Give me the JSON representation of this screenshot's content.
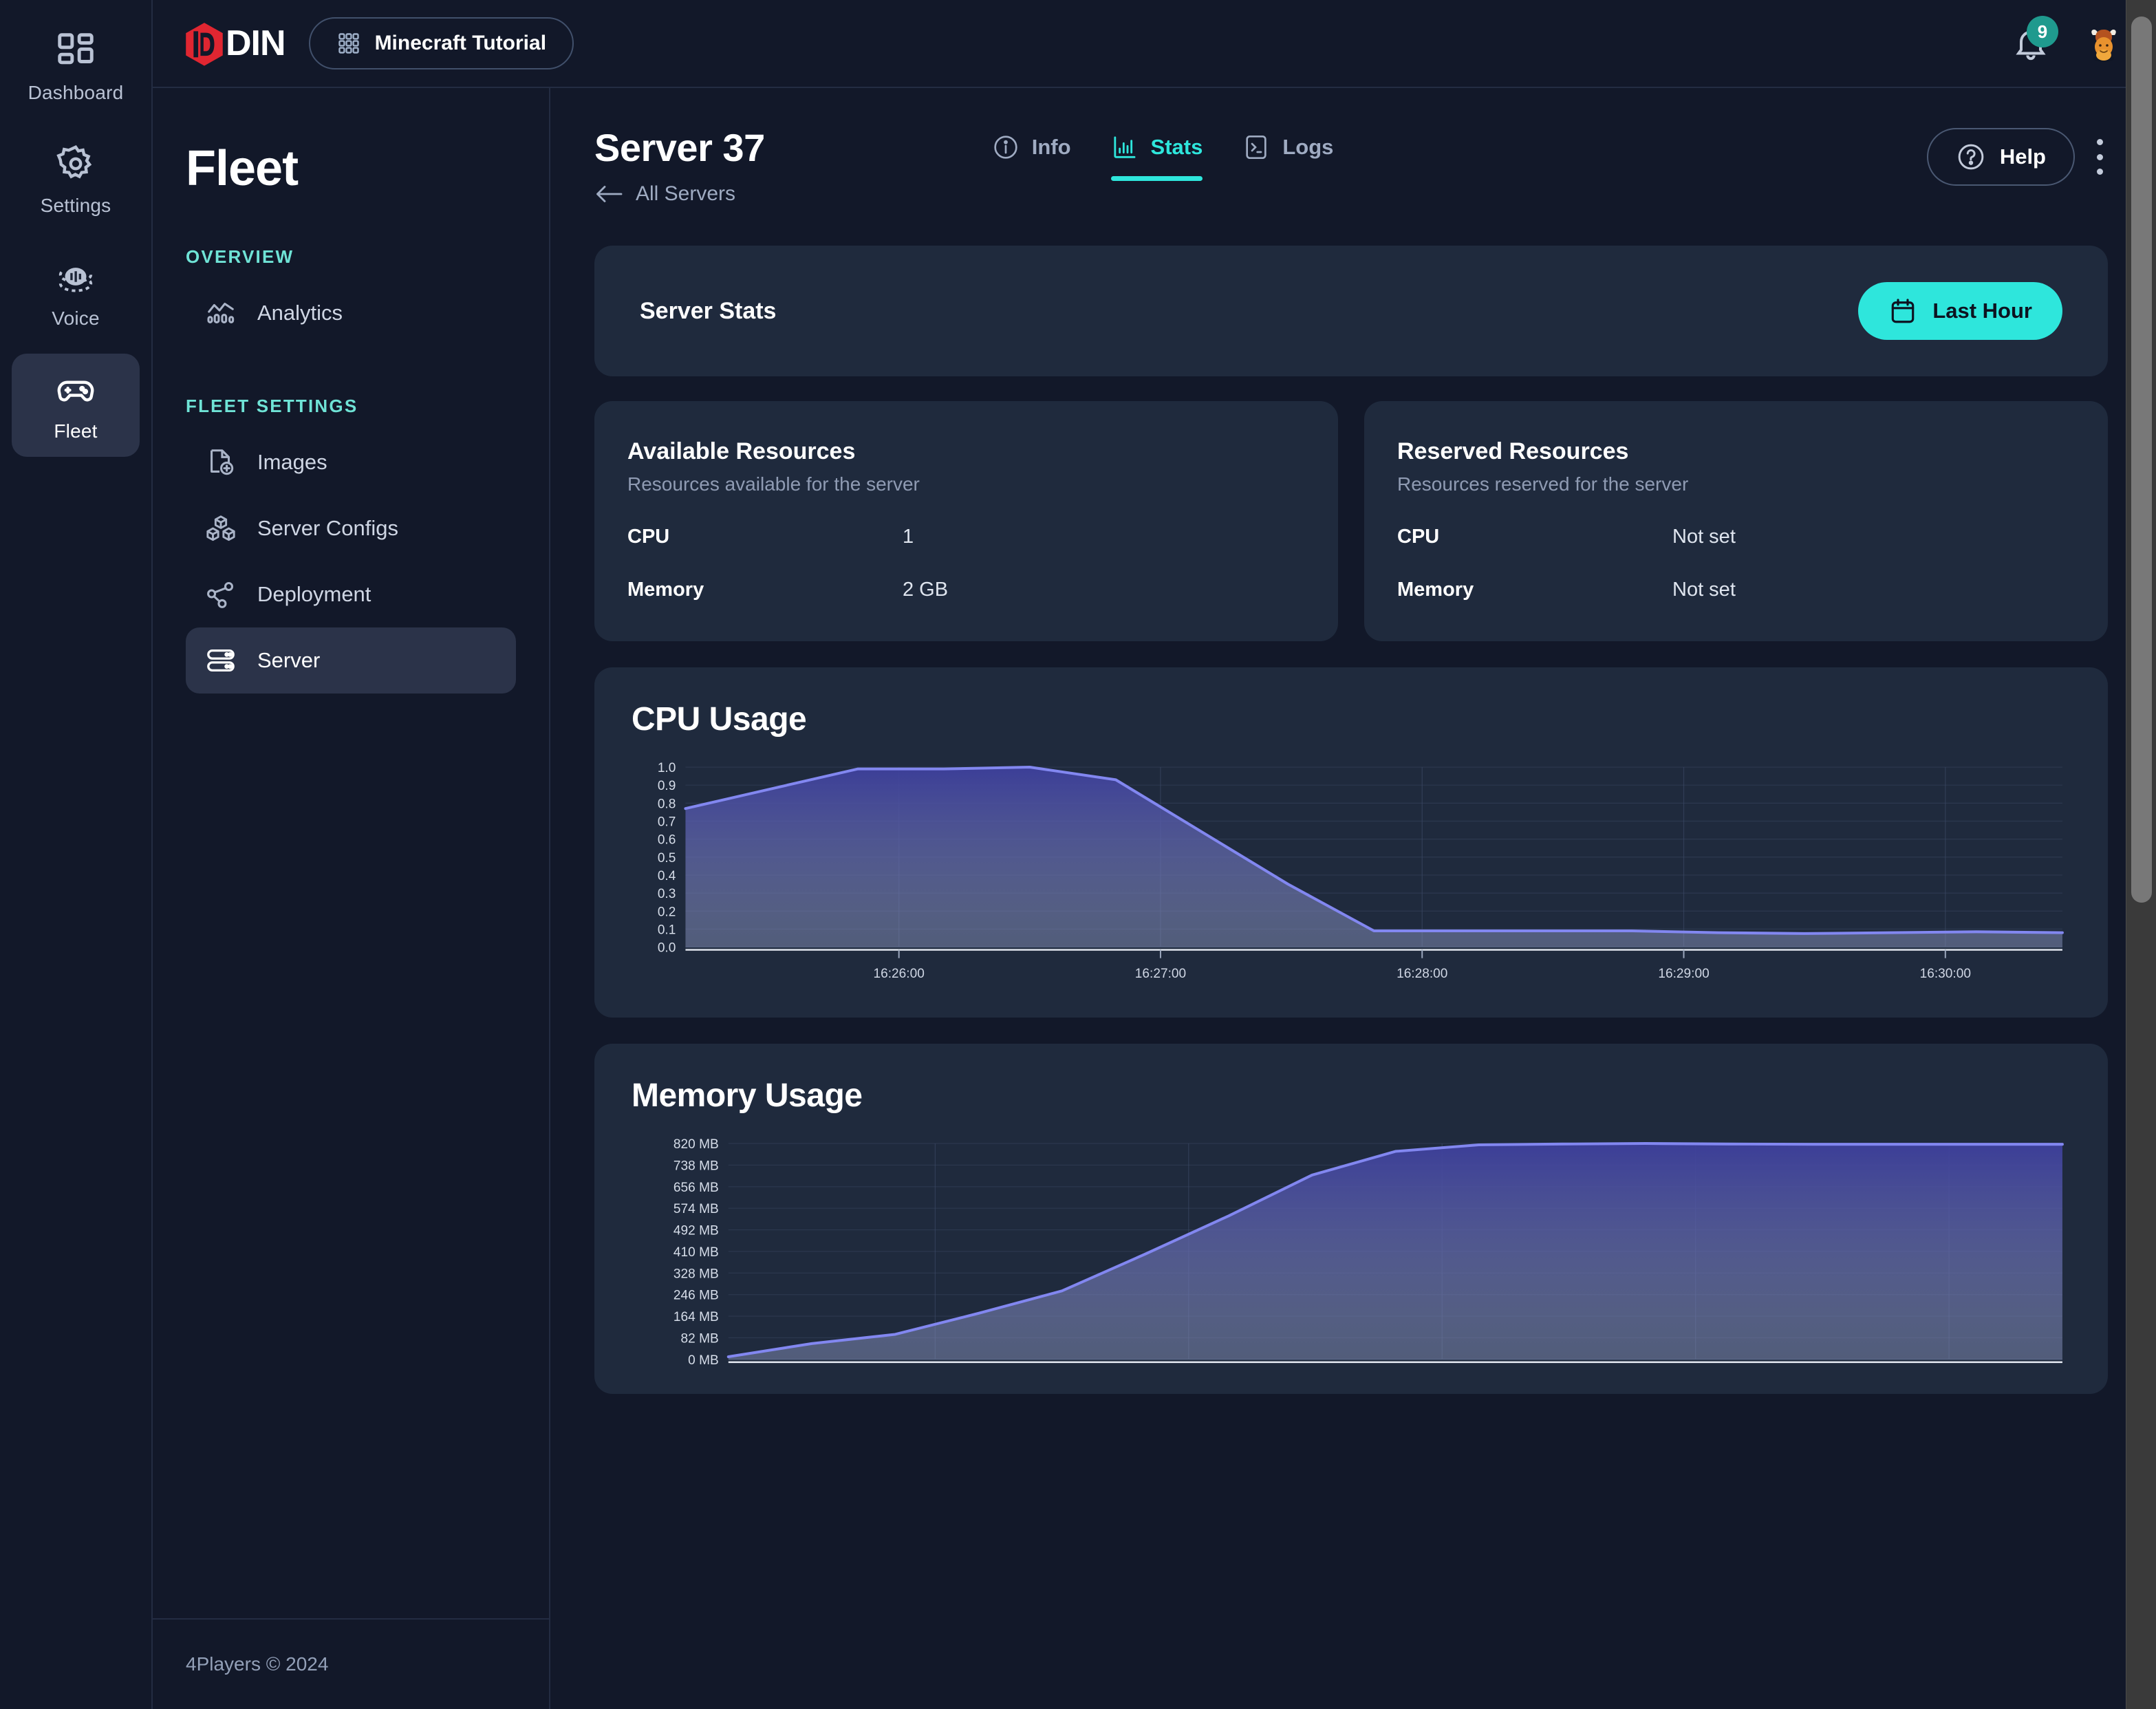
{
  "colors": {
    "bg": "#121829",
    "card": "#1f2a3d",
    "accent_cyan": "#2ee6dc",
    "accent_teal_label": "#6fe3d6",
    "logo_red": "#e02631",
    "chart_line": "#8287f0",
    "badge_green": "#1f9a8e"
  },
  "rail": {
    "items": [
      {
        "label": "Dashboard",
        "icon": "dashboard-icon",
        "active": false
      },
      {
        "label": "Settings",
        "icon": "gear-icon",
        "active": false
      },
      {
        "label": "Voice",
        "icon": "voice-icon",
        "active": false
      },
      {
        "label": "Fleet",
        "icon": "gamepad-icon",
        "active": true
      }
    ]
  },
  "topbar": {
    "logo_text": "DIN",
    "logo_icon": "odin-logo-icon",
    "project": {
      "name": "Minecraft Tutorial",
      "icon": "grid-apps-icon"
    },
    "notifications": {
      "icon": "bell-icon",
      "count": "9"
    },
    "avatar": {
      "icon": "viking-avatar-icon"
    }
  },
  "subnav": {
    "title": "Fleet",
    "sections": [
      {
        "label": "OVERVIEW",
        "items": [
          {
            "label": "Analytics",
            "icon": "analytics-icon",
            "active": false
          }
        ]
      },
      {
        "label": "FLEET SETTINGS",
        "items": [
          {
            "label": "Images",
            "icon": "file-plus-icon",
            "active": false
          },
          {
            "label": "Server Configs",
            "icon": "cubes-icon",
            "active": false
          },
          {
            "label": "Deployment",
            "icon": "share-nodes-icon",
            "active": false
          },
          {
            "label": "Server",
            "icon": "server-rack-icon",
            "active": true
          }
        ]
      }
    ],
    "footer": "4Players © 2024"
  },
  "main": {
    "page_title": "Server 37",
    "back_label": "All Servers",
    "back_icon": "arrow-left-icon",
    "tabs": [
      {
        "label": "Info",
        "icon": "info-circle-icon",
        "active": false
      },
      {
        "label": "Stats",
        "icon": "bar-chart-icon",
        "active": true
      },
      {
        "label": "Logs",
        "icon": "terminal-icon",
        "active": false
      }
    ],
    "help": {
      "label": "Help",
      "icon": "question-circle-icon"
    },
    "more_menu_icon": "kebab-menu-icon",
    "stats_bar": {
      "title": "Server Stats",
      "period_label": "Last Hour",
      "period_icon": "calendar-icon"
    },
    "resource_cards": [
      {
        "title": "Available Resources",
        "subtitle": "Resources available for the server",
        "rows": [
          {
            "key": "CPU",
            "value": "1"
          },
          {
            "key": "Memory",
            "value": "2 GB"
          }
        ]
      },
      {
        "title": "Reserved Resources",
        "subtitle": "Resources reserved for the server",
        "rows": [
          {
            "key": "CPU",
            "value": "Not set"
          },
          {
            "key": "Memory",
            "value": "Not set"
          }
        ]
      }
    ]
  },
  "chart_data": [
    {
      "type": "area",
      "title": "CPU Usage",
      "xlabel": "",
      "ylabel": "",
      "grid": true,
      "legend": "none",
      "ylim": [
        0.0,
        1.0
      ],
      "yticks": [
        "0.0",
        "0.1",
        "0.2",
        "0.3",
        "0.4",
        "0.5",
        "0.6",
        "0.7",
        "0.8",
        "0.9",
        "1.0"
      ],
      "xticks": [
        "16:26:00",
        "16:27:00",
        "16:28:00",
        "16:29:00",
        "16:30:00"
      ],
      "x": [
        "16:25:20",
        "16:25:40",
        "16:26:00",
        "16:26:20",
        "16:26:40",
        "16:27:00",
        "16:27:20",
        "16:27:40",
        "16:28:00",
        "16:28:20",
        "16:28:40",
        "16:29:00",
        "16:29:20",
        "16:29:40",
        "16:30:00",
        "16:30:20",
        "16:30:40"
      ],
      "values": [
        0.77,
        0.88,
        0.99,
        0.99,
        1.0,
        0.93,
        0.64,
        0.35,
        0.09,
        0.09,
        0.09,
        0.09,
        0.08,
        0.075,
        0.08,
        0.085,
        0.08
      ]
    },
    {
      "type": "area",
      "title": "Memory Usage",
      "xlabel": "",
      "ylabel": "",
      "grid": true,
      "legend": "none",
      "ylim": [
        0,
        820
      ],
      "yunit": "MB",
      "yticks": [
        "0 MB",
        "82 MB",
        "164 MB",
        "246 MB",
        "328 MB",
        "410 MB",
        "492 MB",
        "574 MB",
        "656 MB",
        "738 MB",
        "820 MB"
      ],
      "xticks": [],
      "x": [
        "16:25:20",
        "16:25:40",
        "16:26:00",
        "16:26:20",
        "16:26:40",
        "16:27:00",
        "16:27:20",
        "16:27:40",
        "16:28:00",
        "16:28:20",
        "16:28:40",
        "16:29:00",
        "16:29:20",
        "16:29:40",
        "16:30:00",
        "16:30:20",
        "16:30:40"
      ],
      "values": [
        10,
        60,
        95,
        175,
        260,
        400,
        545,
        700,
        790,
        815,
        818,
        820,
        818,
        817,
        817,
        817,
        817
      ]
    }
  ]
}
